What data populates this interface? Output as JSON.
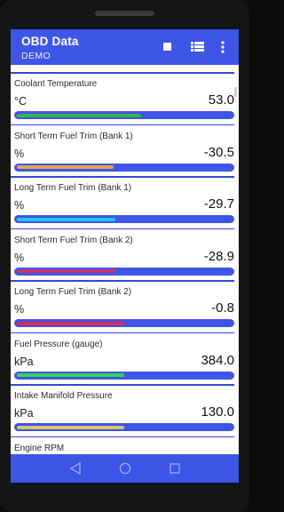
{
  "app": {
    "title": "OBD Data",
    "subtitle": "DEMO"
  },
  "toolbar": {
    "icons": [
      "stop-icon",
      "list-icon",
      "more-vert-icon"
    ]
  },
  "colors": {
    "primary": "#3f55e7",
    "separator": "#2f46e0"
  },
  "pids": [
    {
      "name": "Coolant Temperature",
      "unit": "°C",
      "value": "53.0",
      "bar_color": "#34b24a",
      "level": 0.58
    },
    {
      "name": "Short Term Fuel Trim (Bank 1)",
      "unit": "%",
      "value": "-30.5",
      "bar_color": "#e0a84a",
      "level": 0.45
    },
    {
      "name": "Long Term Fuel Trim (Bank 1)",
      "unit": "%",
      "value": "-29.7",
      "bar_color": "#1ec8ee",
      "level": 0.46
    },
    {
      "name": "Short Term Fuel Trim (Bank 2)",
      "unit": "%",
      "value": "-28.9",
      "bar_color": "#c8336e",
      "level": 0.46
    },
    {
      "name": "Long Term Fuel Trim (Bank 2)",
      "unit": "%",
      "value": "-0.8",
      "bar_color": "#d62f5a",
      "level": 0.5
    },
    {
      "name": "Fuel Pressure (gauge)",
      "unit": "kPa",
      "value": "384.0",
      "bar_color": "#33d64d",
      "level": 0.5
    },
    {
      "name": "Intake Manifold Pressure",
      "unit": "kPa",
      "value": "130.0",
      "bar_color": "#d8c66a",
      "level": 0.5
    },
    {
      "name": "Engine RPM",
      "unit": "",
      "value": "",
      "bar_color": "#3f55e7",
      "level": 0
    }
  ],
  "navigation": {
    "icons": [
      "back-icon",
      "home-icon",
      "recents-icon"
    ]
  }
}
